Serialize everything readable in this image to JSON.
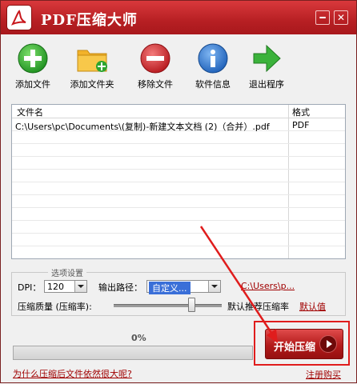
{
  "window": {
    "title": "PDF压缩大师",
    "minimize": "━",
    "close": "✕"
  },
  "toolbar": {
    "add_file": "添加文件",
    "add_folder": "添加文件夹",
    "remove_file": "移除文件",
    "software_info": "软件信息",
    "exit": "退出程序"
  },
  "file_list": {
    "columns": [
      "文件名",
      "格式"
    ],
    "rows": [
      {
        "name": "C:\\Users\\pc\\Documents\\(复制)-新建文本文档 (2)（合并）.pdf",
        "format": "PDF"
      }
    ]
  },
  "settings": {
    "group_title": "选项设置",
    "dpi_label": "DPI：",
    "dpi_value": "120",
    "output_label": "输出路径：",
    "output_value": "自定义...",
    "output_path_link": "C:\\Users\\p...",
    "quality_label": "压缩质量 (压缩率):",
    "quality_hint": "默认推荐压缩率",
    "default_link": "默认值"
  },
  "progress": {
    "percent_text": "0%",
    "value": 0
  },
  "actions": {
    "start": "开始压缩",
    "why_link": "为什么压缩后文件依然很大呢?",
    "register": "注册购买"
  },
  "colors": {
    "title_red": "#b71f23",
    "accent_red": "#e01c1c",
    "link_red": "#a00000"
  }
}
